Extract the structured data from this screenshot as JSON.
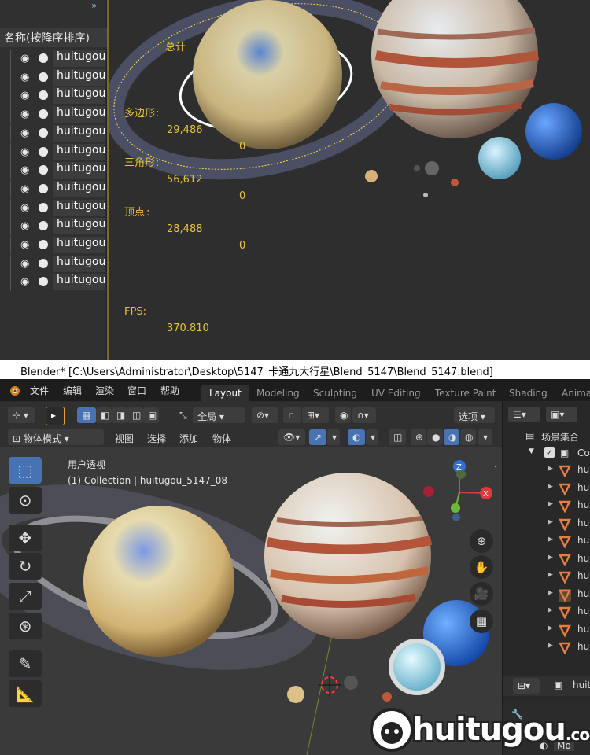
{
  "top_panel": {
    "collapse_glyph": "»",
    "outliner_header": "名称(按降序排序)",
    "rows": [
      {
        "label": "huitugou"
      },
      {
        "label": "huitugou"
      },
      {
        "label": "huitugou"
      },
      {
        "label": "huitugou"
      },
      {
        "label": "huitugou"
      },
      {
        "label": "huitugou"
      },
      {
        "label": "huitugou"
      },
      {
        "label": "huitugou"
      },
      {
        "label": "huitugou"
      },
      {
        "label": "huitugou"
      },
      {
        "label": "huitugou"
      },
      {
        "label": "huitugou"
      },
      {
        "label": "huitugou"
      }
    ],
    "stats": {
      "total_label": "总计",
      "faces_label": "多边形",
      "faces_value": "29,486",
      "faces_sel": "0",
      "tris_label": "三角形",
      "tris_value": "56,612",
      "tris_sel": "0",
      "verts_label": "顶点",
      "verts_value": "28,488",
      "verts_sel": "0",
      "fps_label": "FPS:",
      "fps_value": "370.810"
    }
  },
  "window": {
    "title": "Blender* [C:\\Users\\Administrator\\Desktop\\5147_卡通九大行星\\Blend_5147\\Blend_5147.blend]"
  },
  "menu": {
    "items": [
      "文件",
      "编辑",
      "渲染",
      "窗口",
      "帮助"
    ],
    "workspace_tabs": [
      "Layout",
      "Modeling",
      "Sculpting",
      "UV Editing",
      "Texture Paint",
      "Shading",
      "Animati"
    ],
    "active_tab": "Layout"
  },
  "header": {
    "transform_orientation": "全局",
    "options_label": "选项",
    "mode": "物体模式",
    "menus": [
      "视图",
      "选择",
      "添加",
      "物体"
    ]
  },
  "viewport": {
    "view_name": "用户透视",
    "collection_info": "(1) Collection | huitugou_5147_08",
    "gizmo_axes": {
      "x": "X",
      "y": "Y",
      "z": "Z"
    }
  },
  "right_outliner": {
    "header": "场景集合",
    "collection_label": "Co",
    "rows": [
      "hui",
      "hui",
      "hui",
      "hui",
      "hui",
      "hui",
      "hui",
      "hui",
      "hui",
      "hui",
      "hui"
    ],
    "props_label": "huit",
    "props_sub": "Mo"
  },
  "watermark": {
    "text": "huitugou",
    "suffix": ".com"
  },
  "colors": {
    "accent_blue": "#4772b3",
    "stats_yellow": "#e8c43a",
    "selected_orange": "#e87d3e"
  }
}
